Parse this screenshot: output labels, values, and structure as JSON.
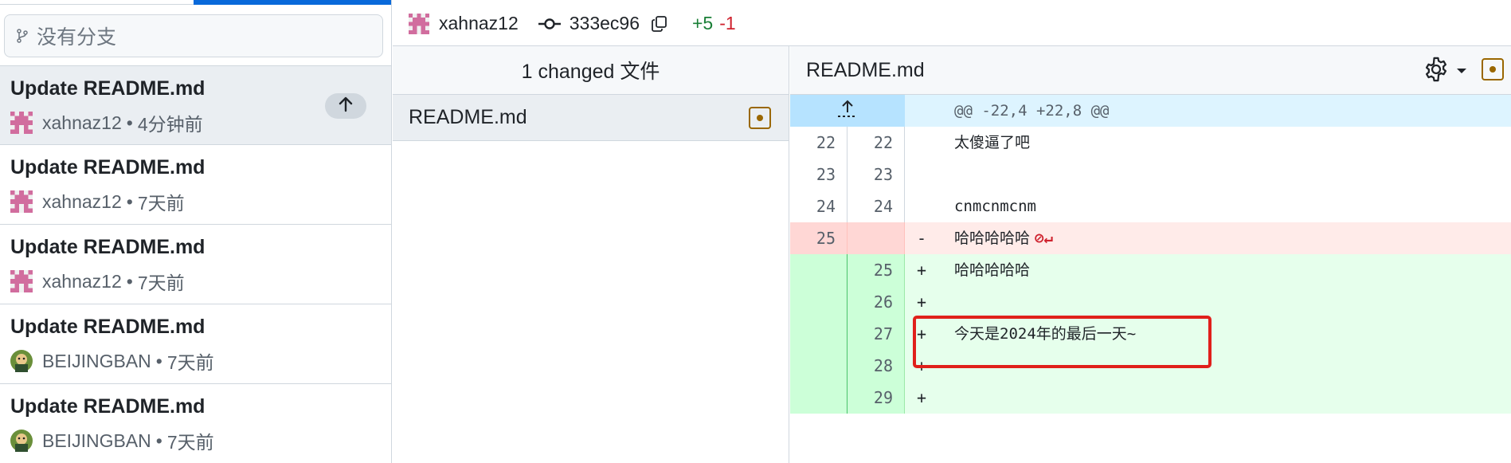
{
  "sidebar": {
    "branch_filter_placeholder": "没有分支",
    "commits": [
      {
        "title": "Update README.md",
        "author": "xahnaz12",
        "time": "4分钟前",
        "selected": true,
        "unpushed": true
      },
      {
        "title": "Update README.md",
        "author": "xahnaz12",
        "time": "7天前"
      },
      {
        "title": "Update README.md",
        "author": "xahnaz12",
        "time": "7天前"
      },
      {
        "title": "Update README.md",
        "author": "BEIJINGBAN",
        "time": "7天前"
      },
      {
        "title": "Update README.md",
        "author": "BEIJINGBAN",
        "time": "7天前"
      }
    ],
    "separator": "•"
  },
  "header": {
    "author": "xahnaz12",
    "sha": "333ec96",
    "additions": "+5",
    "deletions": "-1"
  },
  "files": {
    "heading": "1 changed 文件",
    "items": [
      {
        "name": "README.md",
        "status": "modified"
      }
    ]
  },
  "diff": {
    "file_name": "README.md",
    "hunk_header": "@@ -22,4 +22,8 @@",
    "lines": [
      {
        "type": "ctx",
        "old": "22",
        "new": "22",
        "marker": "",
        "text": "太傻逼了吧"
      },
      {
        "type": "ctx",
        "old": "23",
        "new": "23",
        "marker": "",
        "text": ""
      },
      {
        "type": "ctx",
        "old": "24",
        "new": "24",
        "marker": "",
        "text": "cnmcnmcnm"
      },
      {
        "type": "del",
        "old": "25",
        "new": "",
        "marker": "-",
        "text": "哈哈哈哈哈"
      },
      {
        "type": "add",
        "old": "",
        "new": "25",
        "marker": "+",
        "text": "哈哈哈哈哈"
      },
      {
        "type": "add",
        "old": "",
        "new": "26",
        "marker": "+",
        "text": ""
      },
      {
        "type": "add",
        "old": "",
        "new": "27",
        "marker": "+",
        "text": "今天是2024年的最后一天~"
      },
      {
        "type": "add",
        "old": "",
        "new": "28",
        "marker": "+",
        "text": ""
      },
      {
        "type": "add",
        "old": "",
        "new": "29",
        "marker": "+",
        "text": ""
      }
    ]
  },
  "colors": {
    "accent": "#0969da",
    "added": "#1a7f37",
    "removed": "#cf222e",
    "highlight": "#e0201b"
  }
}
